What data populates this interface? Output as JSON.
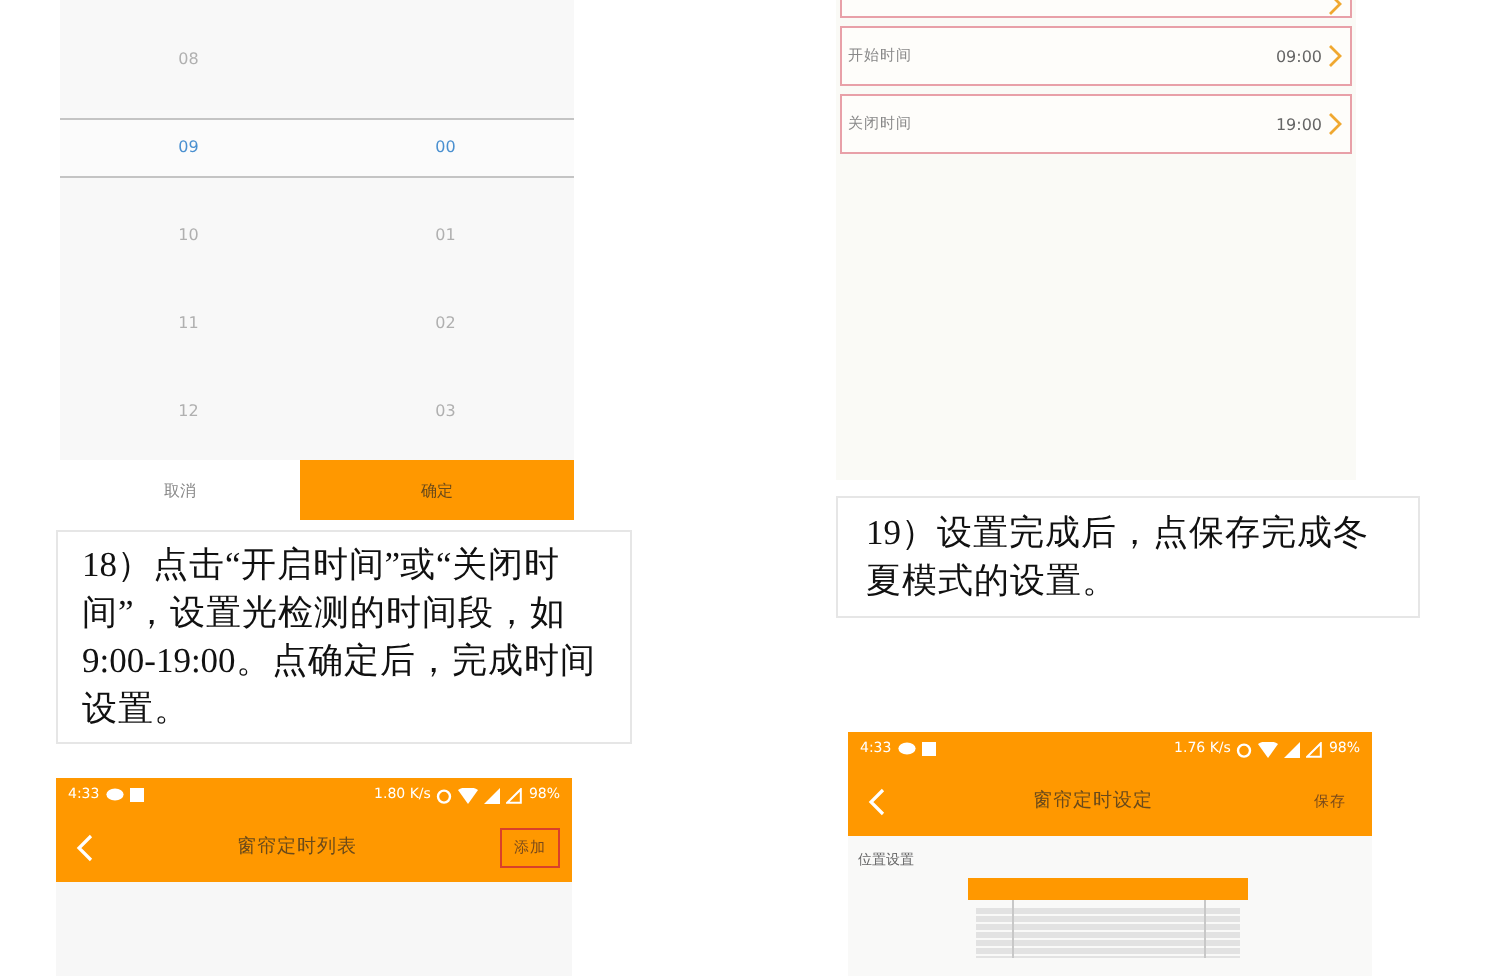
{
  "time_picker": {
    "rows": [
      {
        "hour": "08",
        "selected": false
      },
      {
        "hour": "09",
        "minute": "00",
        "selected": true
      },
      {
        "hour": "10",
        "minute": "01",
        "selected": false
      },
      {
        "hour": "11",
        "minute": "02",
        "selected": false
      },
      {
        "hour": "12",
        "minute": "03",
        "selected": false
      }
    ],
    "buttons": [
      {
        "label": "取消",
        "kind": "cancel"
      },
      {
        "label": "确定",
        "kind": "confirm"
      }
    ]
  },
  "caption_left": "18）点击“开启时间”或“关闭时间”，设置光检测的时间段，如9:00-19:00。点确定后，完成时间设置。",
  "settings_screen": {
    "rows": [
      {
        "kind": "cut",
        "highlighted": true
      },
      {
        "kind": "row",
        "label": "开始时间",
        "value": "09:00",
        "highlighted": true
      },
      {
        "kind": "row",
        "label": "关闭时间",
        "value": "19:00",
        "highlighted": true
      }
    ]
  },
  "caption_right": "19）设置完成后，点保存完成冬夏模式的设置。",
  "phones": [
    {
      "kind": "list",
      "time": "4:33",
      "speed": "1.80 K/s",
      "battery": "98%",
      "title": "窗帘定时列表",
      "action": "添加",
      "action_highlighted": true
    },
    {
      "kind": "settings",
      "time": "4:33",
      "speed": "1.76 K/s",
      "battery": "98%",
      "title": "窗帘定时设定",
      "action": "保存",
      "action_highlighted": false,
      "section_label": "位置设置"
    }
  ]
}
